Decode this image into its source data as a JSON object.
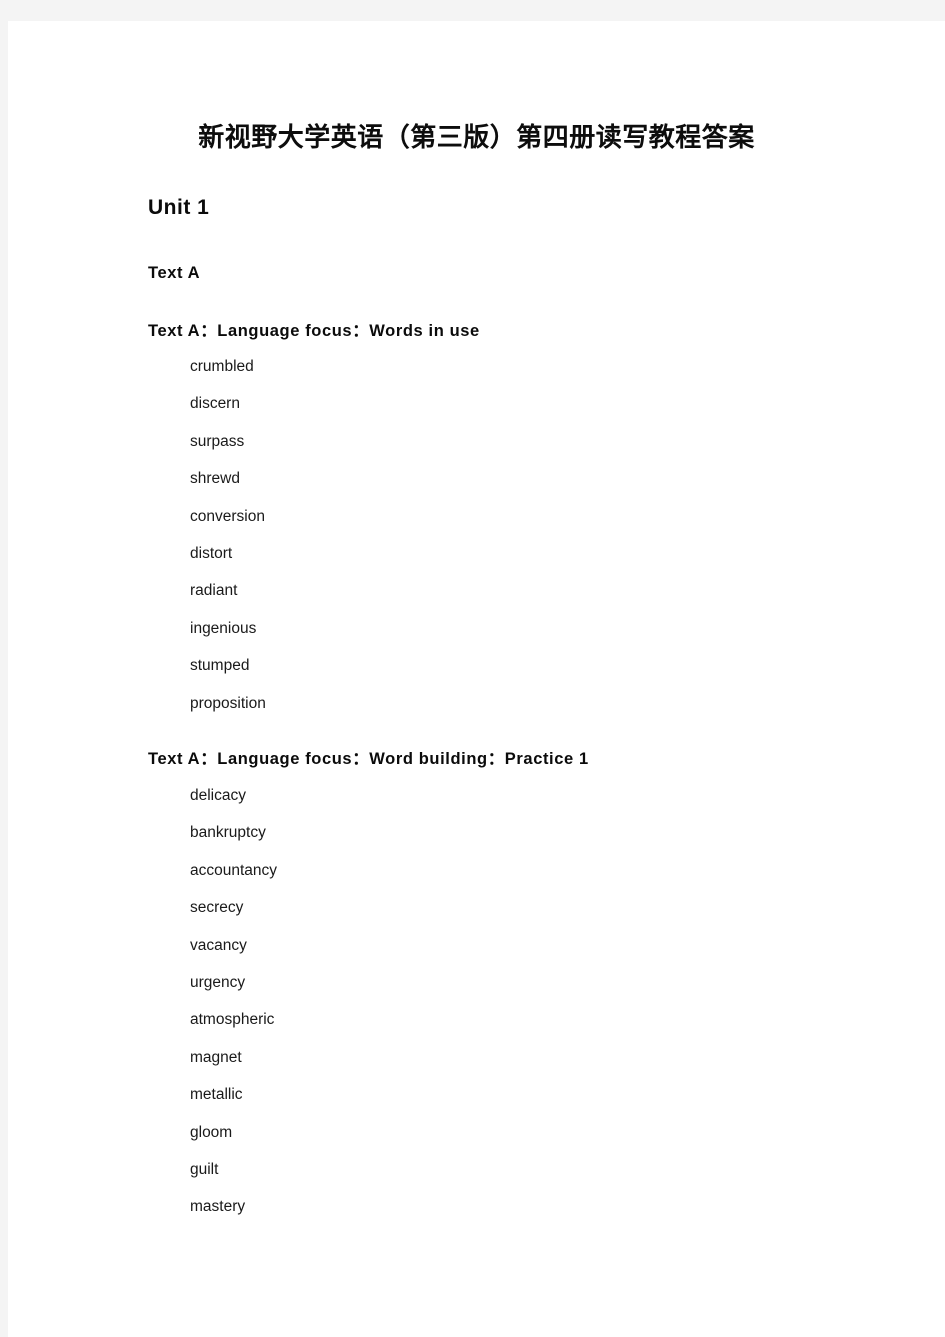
{
  "document": {
    "title": "新视野大学英语（第三版）第四册读写教程答案",
    "unit_heading": "Unit 1",
    "text_heading": "Text A"
  },
  "sections": [
    {
      "heading": "Text A：Language focus：Words in use",
      "answers": [
        "crumbled",
        "discern",
        "surpass",
        "shrewd",
        "conversion",
        "distort",
        "radiant",
        "ingenious",
        "stumped",
        "proposition"
      ]
    },
    {
      "heading": "Text A：Language focus：Word building：Practice 1",
      "answers": [
        "delicacy",
        "bankruptcy",
        "accountancy",
        "secrecy",
        "vacancy",
        "urgency",
        "atmospheric",
        "magnet",
        "metallic",
        "gloom",
        "guilt",
        "mastery"
      ]
    }
  ],
  "colors": {
    "page_background": "#ffffff",
    "canvas_background": "#f4f4f4",
    "text": "#1a1a1a",
    "heading_text": "#0b0b0b"
  }
}
